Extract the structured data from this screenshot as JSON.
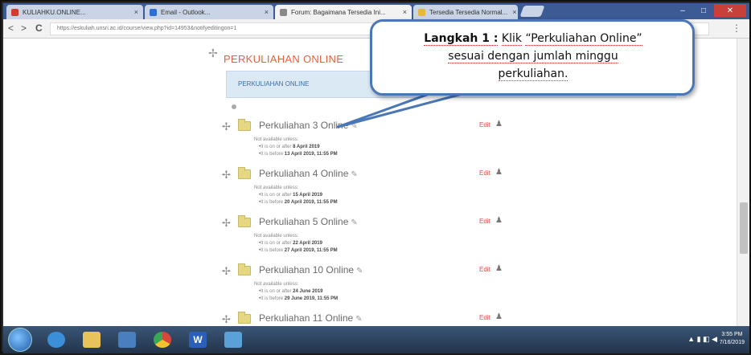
{
  "browser": {
    "tabs": [
      {
        "label": "KULIAHKU.ONLINE...",
        "color": "#d43b2f"
      },
      {
        "label": "Email - Outlook...",
        "color": "#2f6fd4"
      },
      {
        "label": "Forum: Bagaimana Tersedia Ini...",
        "color": "#888888"
      },
      {
        "label": "Tersedia Tersedia Normal...",
        "color": "#e6b93a"
      }
    ],
    "url": "https://eskuliah.unsri.ac.id/course/view.php?id=14953&notifyeditingon=1",
    "nav_back": "<",
    "nav_forward": ">",
    "nav_reload": "C",
    "menu_label": "⋮"
  },
  "page": {
    "section_title": "PERKULIAHAN ONLINE",
    "forum_link": "PERKULIAHAN ONLINE",
    "items": [
      {
        "title": "Perkuliahan 3 Online",
        "edit": "Edit",
        "not_available": "Not available unless:",
        "cond1_prefix": "It is on or after",
        "cond1_date": "8 April 2019",
        "cond2_prefix": "It is before",
        "cond2_date": "13 April 2019, 11:55 PM"
      },
      {
        "title": "Perkuliahan 4 Online",
        "edit": "Edit",
        "not_available": "Not available unless:",
        "cond1_prefix": "It is on or after",
        "cond1_date": "15 April 2019",
        "cond2_prefix": "It is before",
        "cond2_date": "20 April 2019, 11:55 PM"
      },
      {
        "title": "Perkuliahan 5 Online",
        "edit": "Edit",
        "not_available": "Not available unless:",
        "cond1_prefix": "It is on or after",
        "cond1_date": "22 April 2019",
        "cond2_prefix": "It is before",
        "cond2_date": "27 April 2019, 11:55 PM"
      },
      {
        "title": "Perkuliahan 10 Online",
        "edit": "Edit",
        "not_available": "Not available unless:",
        "cond1_prefix": "It is on or after",
        "cond1_date": "24 June 2019",
        "cond2_prefix": "It is before",
        "cond2_date": "29 June 2019, 11:55 PM"
      },
      {
        "title": "Perkuliahan 11 Online",
        "edit": "Edit"
      }
    ]
  },
  "callout": {
    "step": "Langkah 1 :",
    "klik": "Klik",
    "target": "“Perkuliahan Online”",
    "line2": "sesuai dengan jumlah minggu",
    "line3": "perkuliahan."
  },
  "taskbar": {
    "apps": [
      {
        "name": "ie",
        "color": "#3b8fd9"
      },
      {
        "name": "explorer",
        "color": "#e8c25a"
      },
      {
        "name": "files",
        "color": "#4a7fbf"
      },
      {
        "name": "chrome",
        "color": "#d9473b"
      },
      {
        "name": "word",
        "color": "#2b5fb8"
      },
      {
        "name": "paint",
        "color": "#5aa0d9"
      }
    ],
    "time": "3:55 PM",
    "date": "7/16/2019"
  }
}
